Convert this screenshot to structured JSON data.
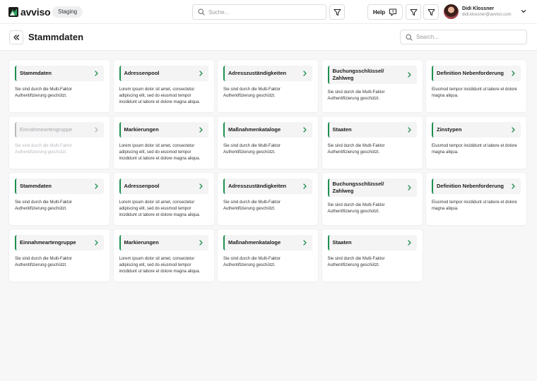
{
  "app": {
    "logo_text": "avviso",
    "environment": "Staging",
    "search_placeholder": "Suche...",
    "help_label": "Help"
  },
  "user": {
    "name": "Didi Klossner",
    "email": "didi.klossner@avviso.com"
  },
  "page": {
    "title": "Stammdaten",
    "search_placeholder": "Search..."
  },
  "colors": {
    "accent": "#1e8e4e",
    "disabled": "#b8b9bd"
  },
  "cards": [
    {
      "title": "Stammdaten",
      "body": "Sie sind durch die Multi-Faktor Authentifizierung geschützt.",
      "disabled": false
    },
    {
      "title": "Adressenpool",
      "body": "Lorem ipsum dolor sit amet, consectetur adipiscing elit, sed do eiusmod tempor incididunt ut labore et dolore magna aliqua.",
      "disabled": false
    },
    {
      "title": "Adresszuständigkeiten",
      "body": "Sie sind durch die Multi-Faktor Authentifizierung geschützt.",
      "disabled": false
    },
    {
      "title": "Buchungsschlüssel/ Zahlweg",
      "body": "Sie sind durch die Multi-Faktor Authentifizierung geschützt.",
      "disabled": false
    },
    {
      "title": "Definition Nebenforderung",
      "body": "Eiusmod tempor incididunt ut labore et dolore magna aliqua.",
      "disabled": false
    },
    {
      "title": "Einnahmeartengruppe",
      "body": "Sie sind durch die Multi-Faktor Authentifizierung geschützt.",
      "disabled": true
    },
    {
      "title": "Markierungen",
      "body": "Lorem ipsum dolor sit amet, consectetur adipiscing elit, sed do eiusmod tempor incididunt ut labore et dolore magna aliqua.",
      "disabled": false
    },
    {
      "title": "Maßnahmenkataloge",
      "body": "Sie sind durch die Multi-Faktor Authentifizierung geschützt.",
      "disabled": false
    },
    {
      "title": "Staaten",
      "body": "Sie sind durch die Multi-Faktor Authentifizierung geschützt.",
      "disabled": false
    },
    {
      "title": "Zinstypen",
      "body": "Eiusmod tempor incididunt ut labore et dolore magna aliqua.",
      "disabled": false
    },
    {
      "title": "Stammdaten",
      "body": "Sie sind durch die Multi-Faktor Authentifizierung geschützt.",
      "disabled": false
    },
    {
      "title": "Adressenpool",
      "body": "Lorem ipsum dolor sit amet, consectetur adipiscing elit, sed do eiusmod tempor incididunt ut labore et dolore magna aliqua.",
      "disabled": false
    },
    {
      "title": "Adresszuständigkeiten",
      "body": "Sie sind durch die Multi-Faktor Authentifizierung geschützt.",
      "disabled": false
    },
    {
      "title": "Buchungsschlüssel/ Zahlweg",
      "body": "Sie sind durch die Multi-Faktor Authentifizierung geschützt.",
      "disabled": false
    },
    {
      "title": "Definition Nebenforderung",
      "body": "Eiusmod tempor incididunt ut labore et dolore magna aliqua.",
      "disabled": false
    },
    {
      "title": "Einnahmeartengruppe",
      "body": "Sie sind durch die Multi-Faktor Authentifizierung geschützt.",
      "disabled": false
    },
    {
      "title": "Markierungen",
      "body": "Lorem ipsum dolor sit amet, consectetur adipiscing elit, sed do eiusmod tempor incididunt ut labore et dolore magna aliqua.",
      "disabled": false
    },
    {
      "title": "Maßnahmenkataloge",
      "body": "Sie sind durch die Multi-Faktor Authentifizierung geschützt.",
      "disabled": false
    },
    {
      "title": "Staaten",
      "body": "Sie sind durch die Multi-Faktor Authentifizierung geschützt.",
      "disabled": false
    }
  ]
}
